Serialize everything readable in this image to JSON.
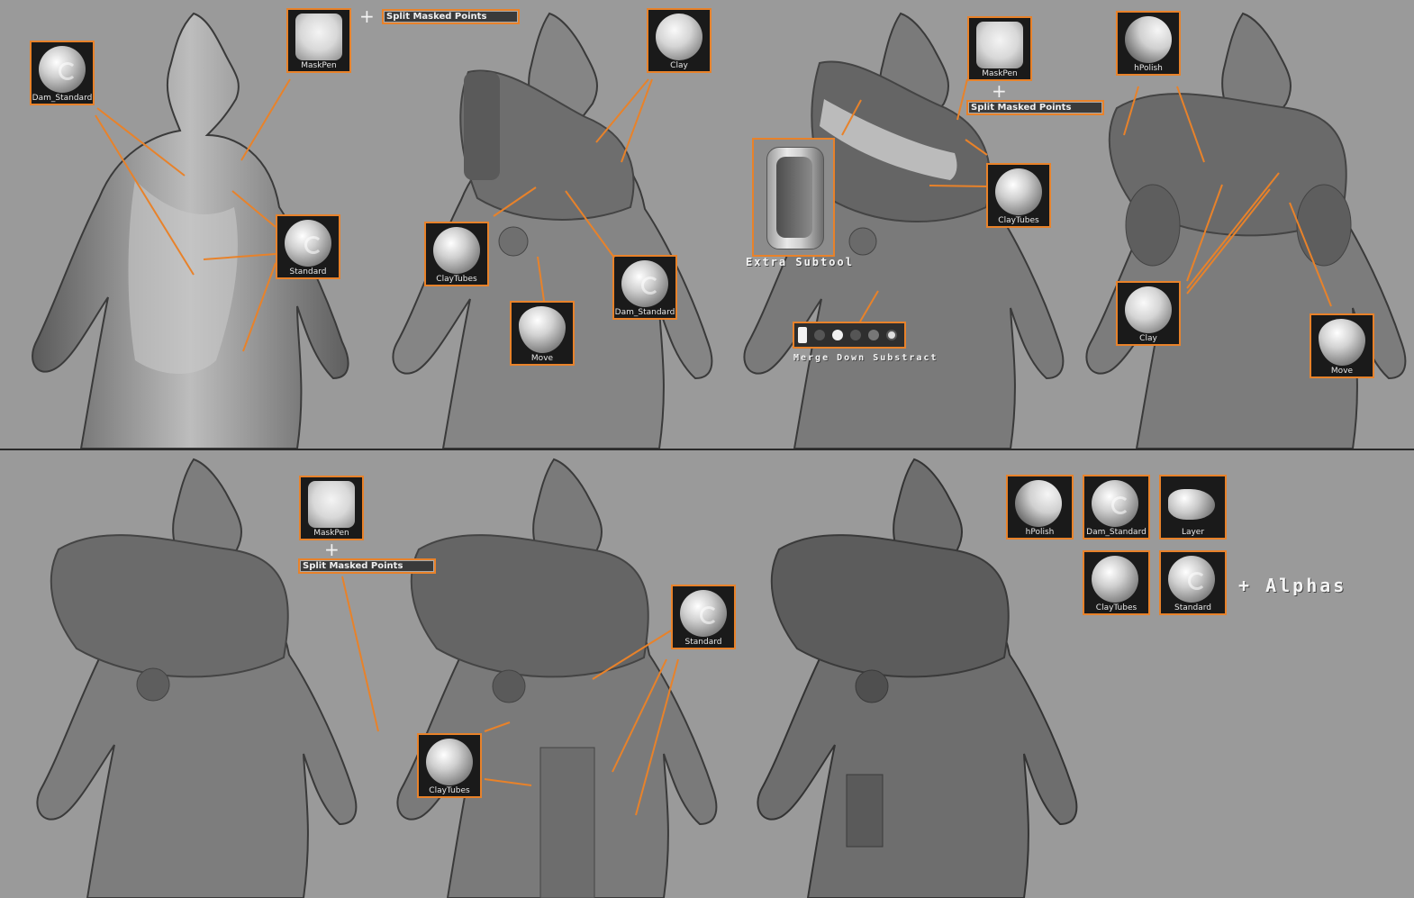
{
  "colors": {
    "accent": "#e8822a",
    "background": "#9a9a9a"
  },
  "top": {
    "brushes": {
      "dam_standard_1": "Dam_Standard",
      "maskpen_1": "MaskPen",
      "standard_1": "Standard",
      "clay_1": "Clay",
      "claytubes_1": "ClayTubes",
      "move_1": "Move",
      "dam_standard_2": "Dam_Standard",
      "maskpen_2": "MaskPen",
      "claytubes_2": "ClayTubes",
      "hpolish_1": "hPolish",
      "clay_2": "Clay",
      "move_2": "Move"
    },
    "split_1": "Split Masked Points",
    "split_2": "Split Masked Points",
    "plus_1": "+",
    "plus_2": "+",
    "extra_subtool": "Extra Subtool",
    "merge_down": "Merge Down Substract"
  },
  "bottom": {
    "brushes": {
      "maskpen": "MaskPen",
      "standard": "Standard",
      "claytubes": "ClayTubes",
      "hpolish": "hPolish",
      "dam_standard": "Dam_Standard",
      "layer": "Layer",
      "claytubes_2": "ClayTubes",
      "standard_2": "Standard"
    },
    "split": "Split Masked Points",
    "plus": "+",
    "alphas": "+ Alphas"
  }
}
